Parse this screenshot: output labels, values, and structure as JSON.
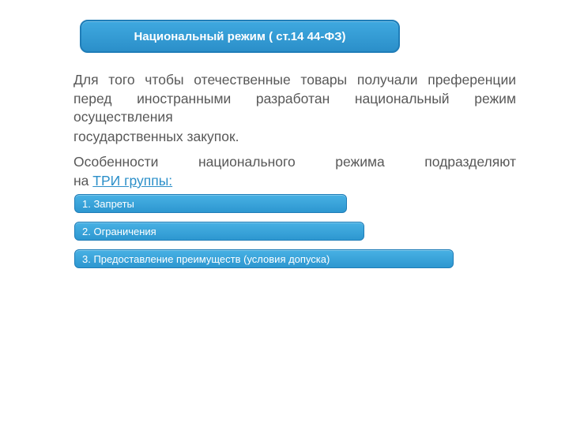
{
  "header": {
    "title": "Национальный режим ( ст.14 44-ФЗ)"
  },
  "body": {
    "para1_line1to3": "Для того чтобы отечественные товары получали преференции перед иностранными разработан национальный режим осуществления",
    "para1_line4": "государственных закупок.",
    "para2_line1": "Особенности национального режима подразделяют",
    "para2_line2_prefix": "на ",
    "para2_line2_link": "ТРИ группы:"
  },
  "groups": {
    "item1": "1. Запреты",
    "item2": "2. Ограничения",
    "item3": "3. Предоставление преимуществ (условия допуска)"
  }
}
